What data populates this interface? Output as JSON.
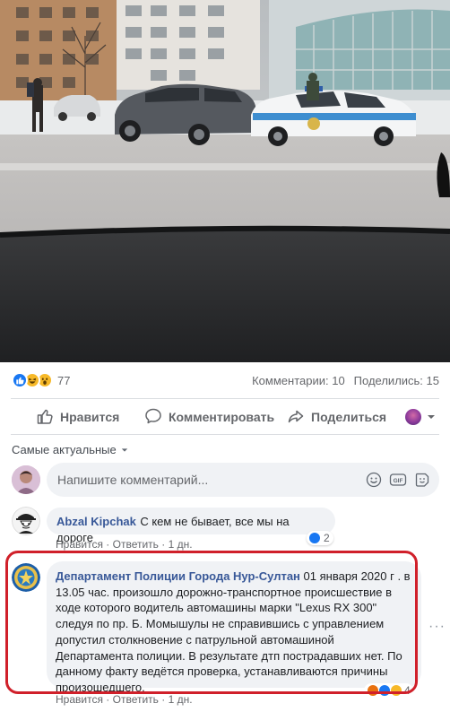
{
  "post": {
    "reaction_count": "77",
    "comments_count": "Комментарии: 10",
    "shares_count": "Поделились: 15"
  },
  "actions": {
    "like": "Нравится",
    "comment": "Комментировать",
    "share": "Поделиться"
  },
  "sort": {
    "label": "Самые актуальные"
  },
  "composer": {
    "placeholder": "Напишите комментарий..."
  },
  "comments": [
    {
      "author": "Abzal Kipchak",
      "text": "С кем не бывает, все мы на дороге",
      "like": "Нравится",
      "reply": "Ответить",
      "time": "1 дн.",
      "reactions": "2"
    },
    {
      "author": "Департамент Полиции Города Нур-Султан",
      "text": "01 января 2020 г . в 13.05 час. произошло дорожно-транспортное происшествие в ходе которого водитель автомашины марки \"Lexus RX 300\" следуя по пр. Б. Момышулы не справившись с управлением допустил столкновение с патрульной автомашиной Департамента полиции. В результате дтп пострадавших нет. По данному факту ведётся проверка, устанавливаются причины произошедшего.",
      "like": "Нравится",
      "reply": "Ответить",
      "time": "1 дн.",
      "reactions": "4"
    }
  ],
  "colors": {
    "link": "#385898",
    "accent": "#1877f2",
    "highlight": "#d0202a",
    "muted": "#65676b"
  },
  "icons": [
    "like-icon",
    "haha-icon",
    "wow-icon",
    "thumb-up-icon",
    "comment-icon",
    "share-icon",
    "chevron-down-icon",
    "emoji-icon",
    "gif-icon",
    "sticker-icon",
    "more-icon"
  ]
}
